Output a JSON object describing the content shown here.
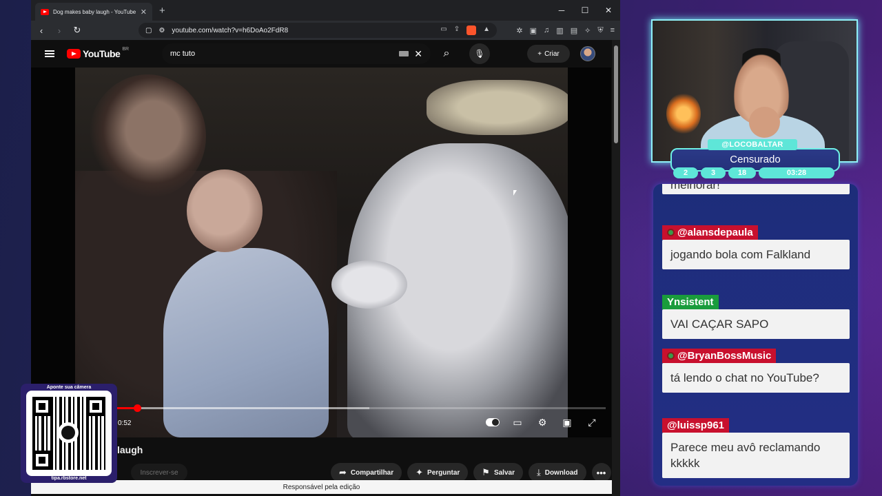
{
  "browser": {
    "tab_title": "Dog makes baby laugh - YouTube",
    "new_tab": "+",
    "url": "youtube.com/watch?v=h6DoAo2FdR8",
    "win_min": "─",
    "win_max": "☐",
    "win_close": "✕"
  },
  "youtube": {
    "logo": "YouTube",
    "country": "BR",
    "search_query": "mc tuto",
    "create_label": "Criar",
    "time_label": "0:52",
    "video_title": "laugh",
    "subscribe_label": "Inscrever-se",
    "progress_played_fraction": 0.048,
    "progress_buffered_fraction": 0.52,
    "actions": {
      "share": "Compartilhar",
      "ask": "Perguntar",
      "save": "Salvar",
      "download": "Download"
    },
    "notice": "Responsável pela edição"
  },
  "qr": {
    "top_label": "Aponte sua câmera",
    "bottom_label": "tipa.rbstore.net"
  },
  "stream": {
    "username": "@LOCOBALTAR",
    "status": "Censurado",
    "stats": [
      "2",
      "3",
      "18",
      "03:28"
    ]
  },
  "chat": {
    "partial_text": "melhorar!",
    "messages": [
      {
        "name": "@alansdepaula",
        "name_color": "#c8102e",
        "badge": true,
        "text": "jogando bola com Falkland"
      },
      {
        "name": "Ynsistent",
        "name_color": "#1a9c3c",
        "badge": false,
        "text": "VAI CAÇAR SAPO"
      },
      {
        "name": "@BryanBossMusic",
        "name_color": "#c8102e",
        "badge": true,
        "text": "tá lendo o chat no YouTube?"
      },
      {
        "name": "@luissp961",
        "name_color": "#c8102e",
        "badge": false,
        "text": "Parece meu avô reclamando kkkkk"
      }
    ]
  },
  "colors": {
    "accent_cyan": "#5ee6d8",
    "youtube_red": "#ff0000",
    "chat_red": "#c8102e",
    "chat_green": "#1a9c3c"
  }
}
